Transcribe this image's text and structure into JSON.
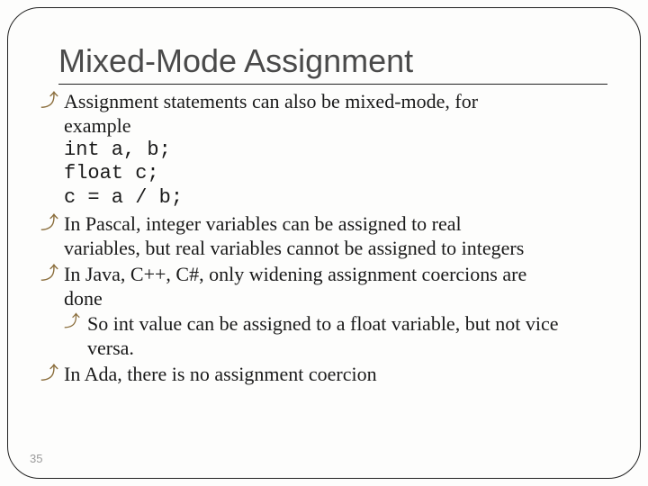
{
  "title": "Mixed-Mode Assignment",
  "bullets": {
    "b1": {
      "line1": "Assignment statements can also be mixed-mode, for",
      "line2": "example"
    },
    "code": {
      "l1": "int a, b;",
      "l2": "float c;",
      "l3": "c = a / b;"
    },
    "b2": {
      "line1": "In Pascal, integer variables can be assigned to real",
      "line2": "variables, but real variables cannot be assigned to integers"
    },
    "b3": {
      "line1": "In Java, C++, C#, only widening assignment coercions are",
      "line2": "done"
    },
    "b3s": {
      "line1": "So int value can be assigned to a float variable, but not vice",
      "line2": "versa."
    },
    "b4": {
      "line1": "In Ada, there is no assignment coercion"
    }
  },
  "marker": "⤴",
  "pagenum": "35"
}
